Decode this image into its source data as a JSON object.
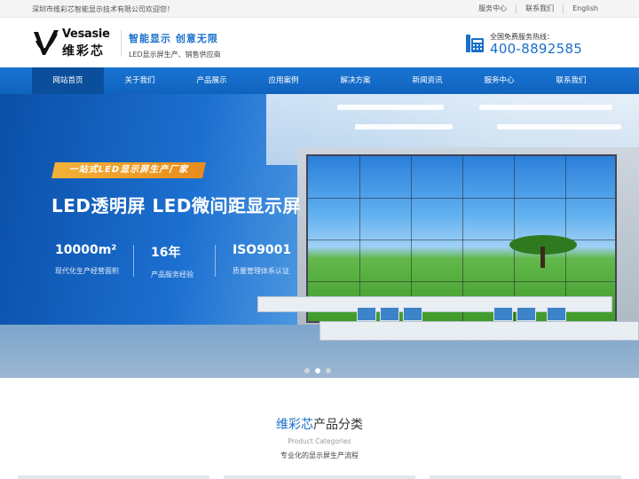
{
  "topbar": {
    "welcome": "深圳市维彩芯智能显示技术有限公司欢迎您！",
    "links": [
      "服务中心",
      "联系我们",
      "English"
    ]
  },
  "header": {
    "logo_en": "Vesasie",
    "logo_cn": "维彩芯",
    "slogan_main": "智能显示 创意无限",
    "slogan_sub": "LED显示屏生产、销售供应商",
    "hotline_label": "全国免费服务热线：",
    "hotline_number": "400-8892585"
  },
  "nav": {
    "items": [
      "网站首页",
      "关于我们",
      "产品展示",
      "应用案例",
      "解决方案",
      "新闻资讯",
      "服务中心",
      "联系我们"
    ],
    "active_index": 0
  },
  "banner": {
    "badge": "一站式LED显示屏生产厂家",
    "headline": "LED透明屏 LED微间距显示屏",
    "stats": [
      {
        "value": "10000m²",
        "label": "现代化生产经营面积"
      },
      {
        "value": "16年",
        "label": "产品服务经验"
      },
      {
        "value": "ISO9001",
        "label": "质量管理体系认证"
      }
    ],
    "slide_count": 3,
    "active_slide": 1
  },
  "section": {
    "title_highlight": "维彩芯",
    "title_rest": "产品分类",
    "title_en": "Product Categories",
    "subtitle": "专业化的显示屏生产流程"
  },
  "colors": {
    "brand_blue": "#1a6fc9",
    "nav_active": "#0b4f9c",
    "badge_orange": "#e98b1b"
  }
}
